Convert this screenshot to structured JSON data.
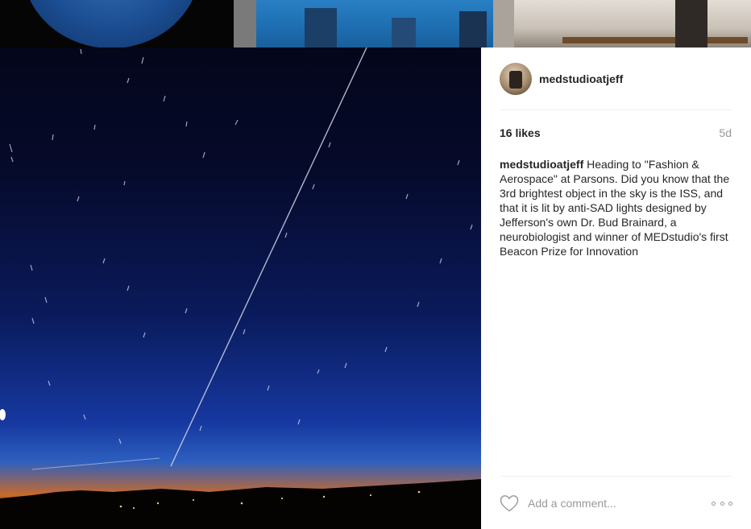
{
  "post": {
    "username": "medstudioatjeff",
    "likes": "16 likes",
    "age": "5d",
    "caption_user": "medstudioatjeff",
    "caption_text": "Heading to \"Fashion & Aerospace\" at Parsons. Did you know that the 3rd brightest object in the sky is the ISS, and that it is lit by anti-SAD lights designed by Jefferson's own Dr. Bud Brainard, a neurobiologist and winner of MEDstudio's first Beacon Prize for Innovation"
  },
  "comment": {
    "placeholder": "Add a comment..."
  },
  "icons": {
    "like": "heart-icon",
    "more": "more-options-icon"
  },
  "colors": {
    "text": "#262626",
    "muted": "#999999",
    "divider": "#efefef"
  }
}
